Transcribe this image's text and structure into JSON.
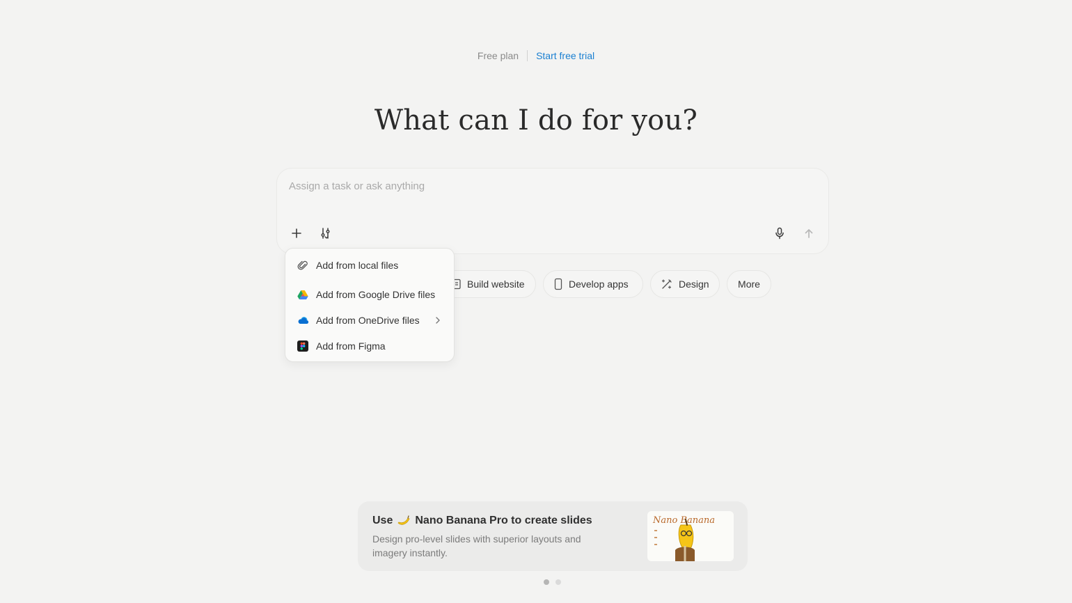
{
  "header": {
    "plan_label": "Free plan",
    "trial_link": "Start free trial"
  },
  "main": {
    "title": "What can I do for you?"
  },
  "composer": {
    "placeholder": "Assign a task or ask anything",
    "value": "",
    "icons": {
      "add": "plus-icon",
      "tools": "tools-icon",
      "mic": "microphone-icon",
      "send": "arrow-up-icon"
    }
  },
  "attach_menu": {
    "items": [
      {
        "label": "Add from local files",
        "icon": "paperclip-icon"
      },
      {
        "label": "Add from Google Drive files",
        "icon": "google-drive-icon"
      },
      {
        "label": "Add from OneDrive files",
        "icon": "onedrive-icon",
        "has_submenu": true
      },
      {
        "label": "Add from Figma",
        "icon": "figma-icon"
      }
    ]
  },
  "quick_actions": [
    {
      "label": "Build website",
      "icon": "browser-icon"
    },
    {
      "label": "Develop apps",
      "icon": "phone-icon"
    },
    {
      "label": "Design",
      "icon": "design-wand-icon"
    },
    {
      "label": "More",
      "icon": ""
    }
  ],
  "promo": {
    "title_prefix": "Use",
    "title_suffix": "Nano Banana Pro to create slides",
    "description": "Design pro-level slides with superior layouts and imagery instantly.",
    "thumbnail_text": "Nano Banana",
    "icon": "banana-icon"
  },
  "carousel": {
    "count": 2,
    "active_index": 0
  },
  "colors": {
    "background": "#f3f3f2",
    "link": "#1a7fd1",
    "text": "#2f2f2f",
    "muted": "#8a8a8a"
  }
}
